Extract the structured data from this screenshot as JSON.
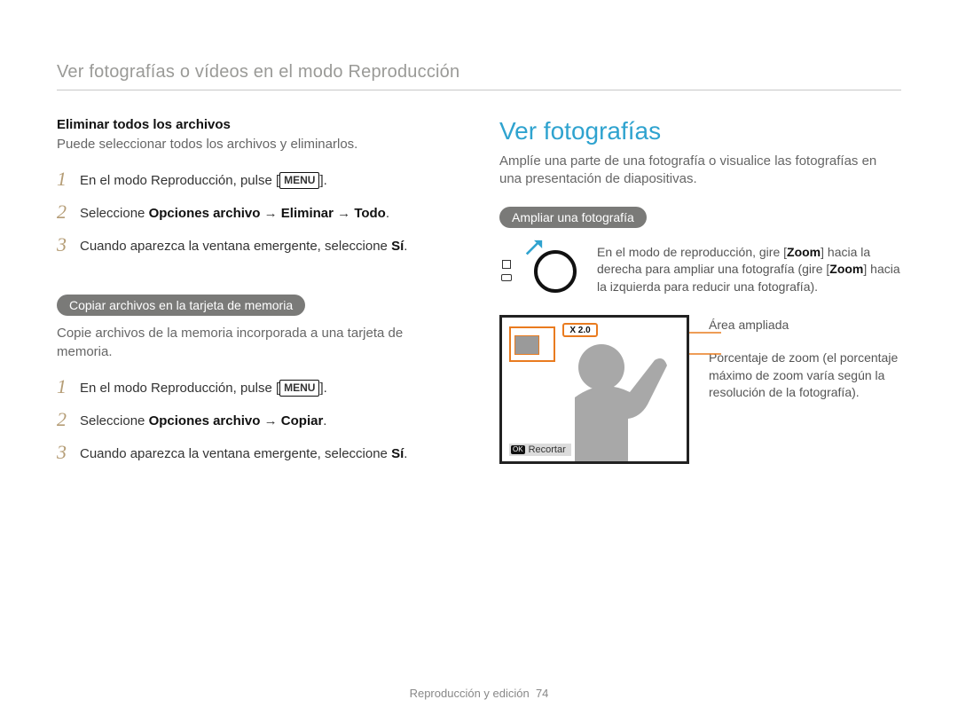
{
  "header": {
    "breadcrumb": "Ver fotografías o vídeos en el modo Reproducción"
  },
  "left": {
    "sec1": {
      "title": "Eliminar todos los archivos",
      "desc": "Puede seleccionar todos los archivos y eliminarlos.",
      "steps": {
        "s1_pre": "En el modo Reproducción, pulse [",
        "s1_menu": "MENU",
        "s1_post": "].",
        "s2_pre": "Seleccione ",
        "s2_b1": "Opciones archivo",
        "s2_arrow1": " → ",
        "s2_b2": "Eliminar",
        "s2_arrow2": " → ",
        "s2_b3": "Todo",
        "s2_post": ".",
        "s3_pre": "Cuando aparezca la ventana emergente, seleccione ",
        "s3_b": "Sí",
        "s3_post": "."
      }
    },
    "sec2": {
      "pill": "Copiar archivos en la tarjeta de memoria",
      "desc": "Copie archivos de la memoria incorporada a una tarjeta de memoria.",
      "steps": {
        "s1_pre": "En el modo Reproducción, pulse [",
        "s1_menu": "MENU",
        "s1_post": "].",
        "s2_pre": "Seleccione ",
        "s2_b1": "Opciones archivo",
        "s2_arrow1": " → ",
        "s2_b2": "Copiar",
        "s2_post": ".",
        "s3_pre": "Cuando aparezca la ventana emergente, seleccione ",
        "s3_b": "Sí",
        "s3_post": "."
      }
    }
  },
  "right": {
    "title": "Ver fotografías",
    "intro": "Amplíe una parte de una fotografía o visualice las fotografías en una presentación de diapositivas.",
    "pill": "Ampliar una fotografía",
    "dial_text_pre": "En el modo de reproducción, gire [",
    "dial_zoom1": "Zoom",
    "dial_text_mid1": "] hacia la derecha para ampliar una fotografía (gire [",
    "dial_zoom2": "Zoom",
    "dial_text_mid2": "] hacia la izquierda para reducir una fotografía).",
    "zoom_badge": "X 2.0",
    "callout1": "Área ampliada",
    "callout2": "Porcentaje de zoom (el porcentaje máximo de zoom varía según la resolución de la fotografía).",
    "trim_ok": "OK",
    "trim_label": "Recortar"
  },
  "footer": {
    "section": "Reproducción y edición",
    "page": "74"
  },
  "step_numbers": {
    "n1": "1",
    "n2": "2",
    "n3": "3"
  }
}
